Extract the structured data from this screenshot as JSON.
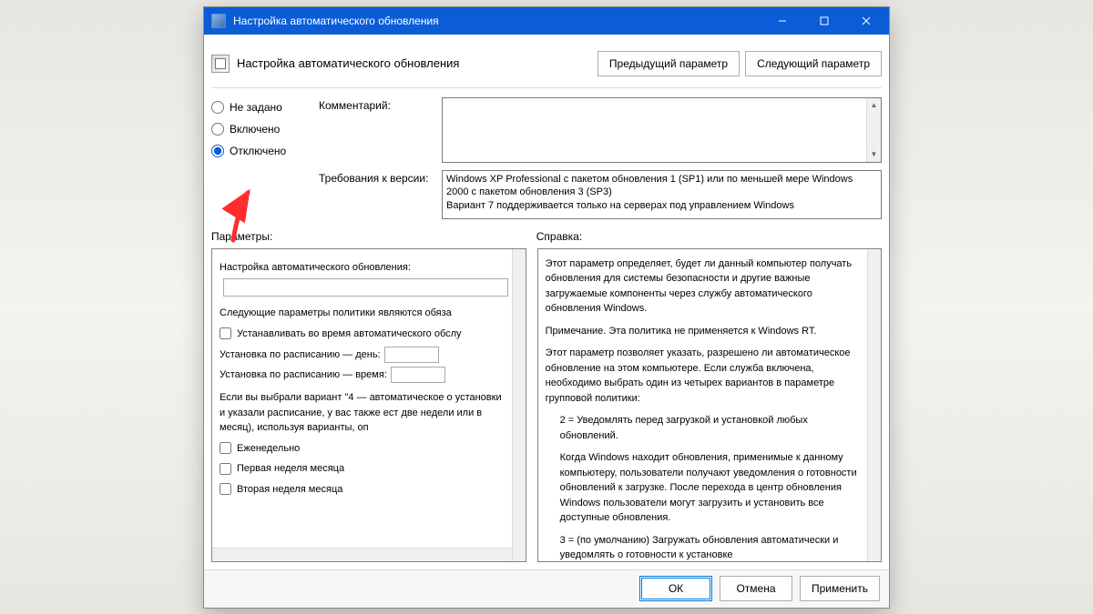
{
  "window": {
    "title": "Настройка автоматического обновления"
  },
  "header": {
    "title": "Настройка автоматического обновления",
    "prev_btn": "Предыдущий параметр",
    "next_btn": "Следующий параметр"
  },
  "radios": {
    "not_configured": "Не задано",
    "enabled": "Включено",
    "disabled": "Отключено",
    "selected": "disabled"
  },
  "fields": {
    "comment_label": "Комментарий:",
    "requirements_label": "Требования к версии:",
    "requirements_text": "Windows XP Professional с пакетом обновления 1 (SP1) или по меньшей мере Windows 2000 с пакетом обновления 3 (SP3)\nВариант 7 поддерживается только на серверах под управлением Windows"
  },
  "sections": {
    "options_label": "Параметры:",
    "help_label": "Справка:"
  },
  "options_panel": {
    "title": "Настройка автоматического обновления:",
    "policy_note": "Следующие параметры политики являются обяза",
    "chk_auto_maint": "Устанавливать во время автоматического обслу",
    "schedule_day": "Установка по расписанию — день:",
    "schedule_time": "Установка по расписанию — время:",
    "variant4_note": "Если вы выбрали вариант \"4 — автоматическое о установки и указали расписание, у вас также ест две недели или в месяц), используя варианты, оп",
    "chk_weekly": "Еженедельно",
    "chk_week1": "Первая неделя месяца",
    "chk_week2": "Вторая неделя месяца"
  },
  "help_panel": {
    "p1": "Этот параметр определяет, будет ли данный компьютер получать обновления для системы безопасности и другие важные загружаемые компоненты через службу автоматического обновления Windows.",
    "p2": "Примечание. Эта политика не применяется к Windows RT.",
    "p3": "Этот параметр позволяет указать, разрешено ли автоматическое обновление на этом компьютере. Если служба включена, необходимо выбрать один из четырех вариантов в параметре групповой политики:",
    "opt2": "2 = Уведомлять перед загрузкой и установкой любых обновлений.",
    "opt2_detail": "Когда Windows находит обновления, применимые к данному компьютеру, пользователи получают уведомления о готовности обновлений к загрузке. После перехода в центр обновления Windows пользователи могут загрузить и установить все доступные обновления.",
    "opt3": "3 = (по умолчанию) Загружать обновления автоматически и уведомлять о готовности к установке"
  },
  "footer": {
    "ok": "ОК",
    "cancel": "Отмена",
    "apply": "Применить"
  }
}
